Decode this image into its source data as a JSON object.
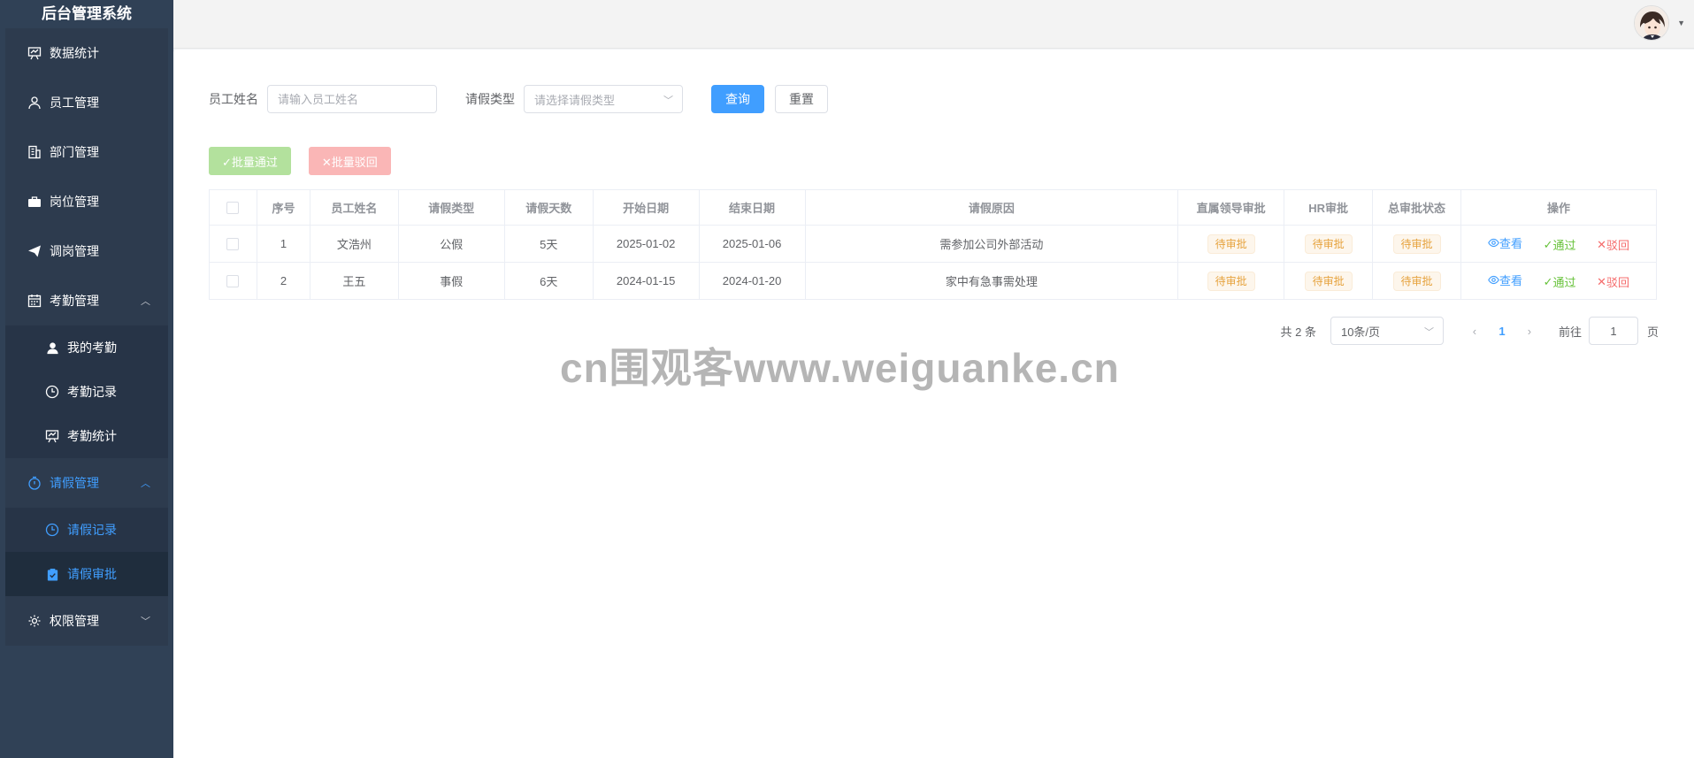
{
  "sidebar": {
    "title": "后台管理系统",
    "items": [
      {
        "label": "数据统计",
        "icon": "presentation-chart-icon"
      },
      {
        "label": "员工管理",
        "icon": "user-icon"
      },
      {
        "label": "部门管理",
        "icon": "office-building-icon"
      },
      {
        "label": "岗位管理",
        "icon": "briefcase-icon"
      },
      {
        "label": "调岗管理",
        "icon": "paper-plane-icon"
      },
      {
        "label": "考勤管理",
        "icon": "calendar-icon",
        "children": [
          {
            "label": "我的考勤",
            "icon": "user-filled-icon"
          },
          {
            "label": "考勤记录",
            "icon": "clock-icon"
          },
          {
            "label": "考勤统计",
            "icon": "presentation-chart-icon"
          }
        ]
      },
      {
        "label": "请假管理",
        "icon": "stopwatch-icon",
        "children": [
          {
            "label": "请假记录",
            "icon": "clock-icon"
          },
          {
            "label": "请假审批",
            "icon": "checked-clipboard-icon"
          }
        ]
      },
      {
        "label": "权限管理",
        "icon": "gear-icon"
      }
    ]
  },
  "search": {
    "name_label": "员工姓名",
    "name_placeholder": "请输入员工姓名",
    "type_label": "请假类型",
    "type_placeholder": "请选择请假类型",
    "query_button": "查询",
    "reset_button": "重置"
  },
  "batch": {
    "approve_label": "✓批量通过",
    "reject_label": "✕批量驳回"
  },
  "table": {
    "headers": [
      "序号",
      "员工姓名",
      "请假类型",
      "请假天数",
      "开始日期",
      "结束日期",
      "请假原因",
      "直属领导审批",
      "HR审批",
      "总审批状态",
      "操作"
    ],
    "rows": [
      {
        "index": "1",
        "name": "文浩州",
        "type": "公假",
        "days": "5天",
        "start": "2025-01-02",
        "end": "2025-01-06",
        "reason": "需参加公司外部活动",
        "leader": "待审批",
        "hr": "待审批",
        "status": "待审批"
      },
      {
        "index": "2",
        "name": "王五",
        "type": "事假",
        "days": "6天",
        "start": "2024-01-15",
        "end": "2024-01-20",
        "reason": "家中有急事需处理",
        "leader": "待审批",
        "hr": "待审批",
        "status": "待审批"
      }
    ],
    "ops": {
      "view": "查看",
      "pass": "通过",
      "reject": "驳回"
    }
  },
  "pagination": {
    "total": "共 2 条",
    "page_size": "10条/页",
    "current": "1",
    "goto_label": "前往",
    "goto_value": "1",
    "page_suffix": "页"
  },
  "watermark": "cn围观客www.weiguanke.cn",
  "colors": {
    "primary": "#409eff",
    "sidebar": "#304156",
    "success": "#67c23a",
    "danger": "#f56c6c",
    "warning": "#e6a23c"
  }
}
